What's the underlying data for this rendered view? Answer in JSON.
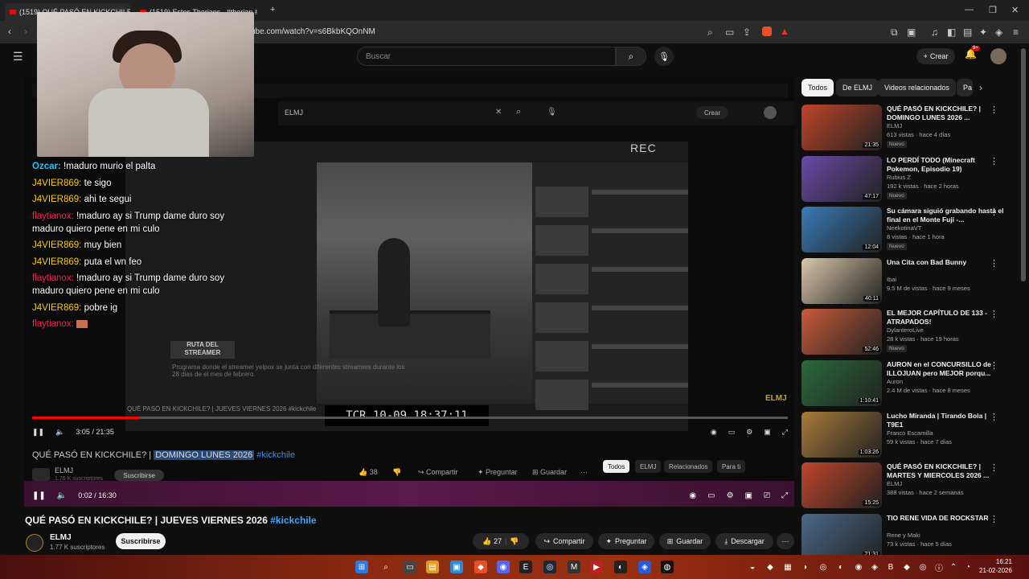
{
  "browser": {
    "tabs": [
      {
        "label": "(1519) QUÉ PASÓ EN KICKCHILE",
        "active": true
      },
      {
        "label": "(1519) Estos Therians...#therian #hum",
        "active": false
      }
    ],
    "url": "ube.com/watch?v=s6BkbKQOnNM",
    "new_tab": "+"
  },
  "yt": {
    "search_placeholder": "Buscar",
    "create_label": "Crear",
    "notif_count": "9+"
  },
  "nested": {
    "search_value": "ELMJ",
    "create_label": "Crear",
    "rec_label": "REC",
    "tcr": "TCR 10-09 18:37:11",
    "ruta": "RUTA DEL STREAMER",
    "desc": "Programa donde el streamer yelpox se junta con diferentes streamers durante los 28 dias de el mes de febrero.",
    "inner_title": "QUÉ PASÓ EN KICKCHILE? | JUEVES VIERNES 2026 #kickchile"
  },
  "player1": {
    "time": "3:05 / 21:35",
    "progress": 0.143
  },
  "chat": [
    {
      "user": "Ozcar:",
      "cls": "u1",
      "text": "!maduro murio el palta"
    },
    {
      "user": "J4VIER869:",
      "cls": "u2",
      "text": "te sigo"
    },
    {
      "user": "J4VIER869:",
      "cls": "u2",
      "text": "ahi te segui"
    },
    {
      "user": "flaytianox:",
      "cls": "u3",
      "text": "!maduro ay si Trump dame duro soy maduro quiero pene en mi culo"
    },
    {
      "user": "J4VIER869:",
      "cls": "u2",
      "text": "muy bien"
    },
    {
      "user": "J4VIER869:",
      "cls": "u2",
      "text": "puta el wn feo"
    },
    {
      "user": "flaytianox:",
      "cls": "u3",
      "text": "!maduro ay si Trump dame duro soy maduro quiero pene en mi culo"
    },
    {
      "user": "J4VIER869:",
      "cls": "u2",
      "text": "pobre ig"
    },
    {
      "user": "flaytianox:",
      "cls": "u3",
      "text": ""
    }
  ],
  "inner_video": {
    "title_pre": "QUÉ PASÓ EN KICKCHILE? | ",
    "title_hl": "DOMINGO LUNES 2026",
    "title_tag": "#kickchile",
    "channel": "ELMJ",
    "subs": "1.76 K suscriptores",
    "subscribe": "Suscribirse",
    "likes": "38",
    "share": "Compartir",
    "ask": "Preguntar",
    "save": "Guardar",
    "chips": [
      "Todos",
      "ELMJ",
      "Relacionados",
      "Para ti"
    ]
  },
  "player2": {
    "time": "0:02 / 16:30"
  },
  "video": {
    "title": "QUÉ PASÓ EN KICKCHILE? | JUEVES VIERNES 2026",
    "tag": "#kickchile",
    "channel": "ELMJ",
    "subs": "1.77 K suscriptores",
    "subscribe": "Suscribirse",
    "likes": "27",
    "share": "Compartir",
    "ask": "Preguntar",
    "save": "Guardar",
    "download": "Descargar"
  },
  "sidebar": {
    "chips": [
      "Todos",
      "De ELMJ",
      "Videos relacionados",
      "Pa"
    ],
    "items": [
      {
        "title": "QUÉ PASÓ EN KICKCHILE? | DOMINGO LUNES 2026 ...",
        "channel": "ELMJ",
        "meta": "613 vistas · hace 4 días",
        "badge": "Nuevo",
        "dur": "21:35",
        "color": "#c0452a"
      },
      {
        "title": "LO PERDÍ TODO (Minecraft Pokemon, Episodio 19)",
        "channel": "Rubius Z",
        "meta": "192 k vistas · hace 2 horas",
        "badge": "Nuevo",
        "dur": "47:17",
        "color": "#6a4aa8"
      },
      {
        "title": "Su cámara siguió grabando hasta el final en el Monte Fuji -...",
        "channel": "NeekotinaVT",
        "meta": "8 vistas · hace 1 hora",
        "badge": "Nuevo",
        "dur": "12:04",
        "color": "#3a7ab8"
      },
      {
        "title": "Una Cita con Bad Bunny",
        "channel": "Ibai",
        "meta": "9.5 M de vistas · hace 9 meses",
        "badge": "",
        "dur": "40:11",
        "color": "#d8c8a8"
      },
      {
        "title": "EL MEJOR CAPÍTULO DE 133 - ATRAPADOS!",
        "channel": "DylanteroLive",
        "meta": "28 k vistas · hace 19 horas",
        "badge": "Nuevo",
        "dur": "52:46",
        "color": "#c85a3a"
      },
      {
        "title": "AURON en el CONCURSILLO de ILLOJUAN pero MEJOR porqu...",
        "channel": "Auron",
        "meta": "2.4 M de vistas · hace 8 meses",
        "badge": "",
        "dur": "1:10:41",
        "color": "#2a6a3a"
      },
      {
        "title": "Lucho Miranda | Tirando Bola | T9E1",
        "channel": "Franco Escamilla",
        "meta": "59 k vistas · hace 7 días",
        "badge": "",
        "dur": "1:03:26",
        "color": "#a87a3a"
      },
      {
        "title": "QUÉ PASÓ EN KICKCHILE? | MARTES Y MIERCOLES 2026 ...",
        "channel": "ELMJ",
        "meta": "388 vistas · hace 2 semanas",
        "badge": "",
        "dur": "15:25",
        "color": "#c0452a"
      },
      {
        "title": "TIO RENE VIDA DE ROCKSTAR",
        "channel": "Rene y Maki",
        "meta": "73 k vistas · hace 5 días",
        "badge": "",
        "dur": "21:31",
        "color": "#4a6a8a"
      }
    ]
  },
  "taskbar": {
    "time": "16:21",
    "date": "21-02-2026"
  }
}
